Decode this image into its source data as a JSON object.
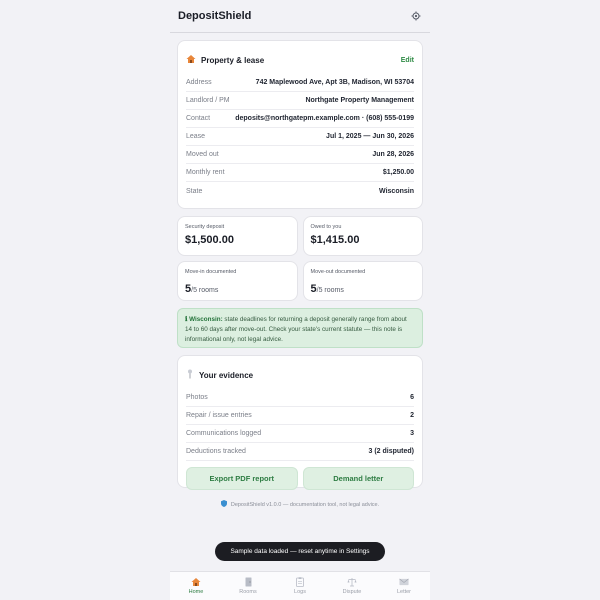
{
  "app": {
    "title": "DepositShield"
  },
  "lease": {
    "title": "Property & lease",
    "edit_label": "Edit",
    "rows": [
      {
        "label": "Address",
        "value": "742 Maplewood Ave, Apt 3B, Madison, WI 53704"
      },
      {
        "label": "Landlord / PM",
        "value": "Northgate Property Management"
      },
      {
        "label": "Contact",
        "value": "deposits@northgatepm.example.com · (608) 555-0199"
      },
      {
        "label": "Lease",
        "value": "Jul 1, 2025 — Jun 30, 2026"
      },
      {
        "label": "Moved out",
        "value": "Jun 28, 2026"
      },
      {
        "label": "Monthly rent",
        "value": "$1,250.00"
      },
      {
        "label": "State",
        "value": "Wisconsin"
      }
    ]
  },
  "stats": {
    "deposit": {
      "label": "Security deposit",
      "value": "$1,500.00"
    },
    "owed": {
      "label": "Owed to you",
      "value": "$1,415.00"
    },
    "move_in": {
      "label": "Move-in documented",
      "count": "5",
      "total": "/5 rooms"
    },
    "move_out": {
      "label": "Move-out documented",
      "count": "5",
      "total": "/5 rooms"
    }
  },
  "note": {
    "prefix": "ℹ Wisconsin:",
    "text": " state deadlines for returning a deposit generally range from about 14 to 60 days after move-out. Check your state's current statute — this note is informational only, not legal advice."
  },
  "evidence": {
    "title": "Your evidence",
    "rows": [
      {
        "label": "Photos",
        "value": "6"
      },
      {
        "label": "Repair / issue entries",
        "value": "2"
      },
      {
        "label": "Communications logged",
        "value": "3"
      },
      {
        "label": "Deductions tracked",
        "value": "3 (2 disputed)"
      }
    ],
    "export_label": "Export PDF report",
    "demand_label": "Demand letter"
  },
  "footer": {
    "text": "DepositShield v1.0.0 — documentation tool, not legal advice."
  },
  "toast": {
    "text": "Sample data loaded — reset anytime in Settings"
  },
  "tabs": [
    {
      "label": "Home",
      "icon": "house-icon",
      "active": true
    },
    {
      "label": "Rooms",
      "icon": "door-icon",
      "active": false
    },
    {
      "label": "Logs",
      "icon": "clipboard-icon",
      "active": false
    },
    {
      "label": "Dispute",
      "icon": "scales-icon",
      "active": false
    },
    {
      "label": "Letter",
      "icon": "envelope-icon",
      "active": false
    }
  ],
  "colors": {
    "accent": "#2e7d43",
    "note_bg": "#dcefe0",
    "toast_bg": "#1c1d22"
  }
}
